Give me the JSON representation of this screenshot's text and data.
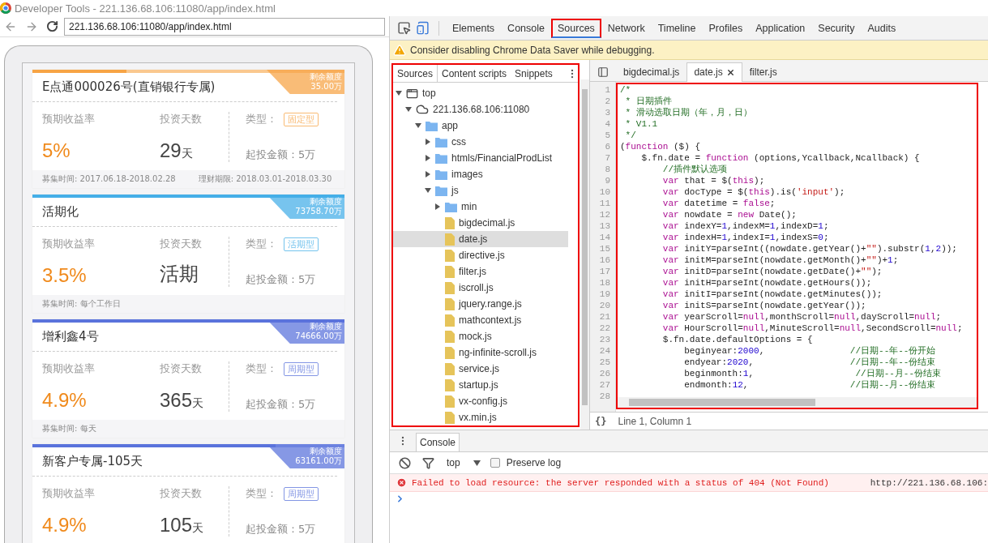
{
  "window": {
    "title": "Developer Tools - 221.136.68.106:11080/app/index.html"
  },
  "browser": {
    "url": "221.136.68.106:11080/app/index.html"
  },
  "products": [
    {
      "name": "E点通000026号(直销银行专属)",
      "color": "#f7a445",
      "level": 0.3,
      "quota_label": "剩余额度",
      "quota_amount": "35.00万",
      "rate_label": "预期收益率",
      "rate": "5%",
      "days_label": "投资天数",
      "days": "29",
      "unit": "天",
      "type_label": "类型：",
      "type": "固定型",
      "min_amount": "起投金额：5万",
      "footer": [
        "募集时间: 2017.06.18-2018.02.28",
        "理财期限: 2018.03.01-2018.03.30"
      ]
    },
    {
      "name": "活期化",
      "color": "#45afe8",
      "level": 1,
      "quota_label": "剩余额度",
      "quota_amount": "73758.70万",
      "rate_label": "预期收益率",
      "rate": "3.5%",
      "days_label": "投资天数",
      "days": "活期",
      "type_label": "类型：",
      "type": "活期型",
      "min_amount": "起投金额：5万",
      "footer": [
        "募集时间: 每个工作日"
      ]
    },
    {
      "name": "增利鑫4号",
      "color": "#5a73dc",
      "level": 1,
      "quota_label": "剩余额度",
      "quota_amount": "74666.00万",
      "rate_label": "预期收益率",
      "rate": "4.9%",
      "days_label": "投资天数",
      "days": "365",
      "unit": "天",
      "type_label": "类型：",
      "type": "周期型",
      "min_amount": "起投金额：5万",
      "footer": [
        "募集时间: 每天"
      ]
    },
    {
      "name": "新客户专属-105天",
      "color": "#5a73dc",
      "level": 0.78,
      "quota_label": "剩余额度",
      "quota_amount": "63161.00万",
      "rate_label": "预期收益率",
      "rate": "4.9%",
      "days_label": "投资天数",
      "days": "105",
      "unit": "天",
      "type_label": "类型：",
      "type": "周期型",
      "min_amount": "起投金额：5万"
    }
  ],
  "devtools": {
    "tabs": [
      {
        "label": "Elements",
        "selected": false,
        "highlighted": false
      },
      {
        "label": "Console",
        "selected": false,
        "highlighted": false
      },
      {
        "label": "Sources",
        "selected": true,
        "highlighted": true
      },
      {
        "label": "Network",
        "selected": false,
        "highlighted": false
      },
      {
        "label": "Timeline",
        "selected": false,
        "highlighted": false
      },
      {
        "label": "Profiles",
        "selected": false,
        "highlighted": false
      },
      {
        "label": "Application",
        "selected": false,
        "highlighted": false
      },
      {
        "label": "Security",
        "selected": false,
        "highlighted": false
      },
      {
        "label": "Audits",
        "selected": false,
        "highlighted": false
      }
    ],
    "warning": "Consider disabling Chrome Data Saver while debugging.",
    "navigator": {
      "highlighted": true,
      "tabs": [
        {
          "label": "Sources",
          "selected": true
        },
        {
          "label": "Content scripts",
          "selected": false
        },
        {
          "label": "Snippets",
          "selected": false
        }
      ],
      "tree": [
        {
          "label": "top",
          "kind": "frame",
          "expanded": true,
          "selected": false,
          "children": [
            {
              "label": "221.136.68.106:11080",
              "kind": "domain",
              "expanded": true,
              "selected": false,
              "children": [
                {
                  "label": "app",
                  "kind": "folder",
                  "expanded": true,
                  "selected": false,
                  "children": [
                    {
                      "label": "css",
                      "kind": "folder",
                      "expanded": false,
                      "selected": false
                    },
                    {
                      "label": "htmls/FinancialProdList",
                      "kind": "folder",
                      "expanded": false,
                      "selected": false
                    },
                    {
                      "label": "images",
                      "kind": "folder",
                      "expanded": false,
                      "selected": false
                    },
                    {
                      "label": "js",
                      "kind": "folder",
                      "expanded": true,
                      "selected": false,
                      "children": [
                        {
                          "label": "min",
                          "kind": "folder",
                          "expanded": false,
                          "selected": false
                        },
                        {
                          "label": "bigdecimal.js",
                          "kind": "file",
                          "selected": false
                        },
                        {
                          "label": "date.js",
                          "kind": "file",
                          "selected": true
                        },
                        {
                          "label": "directive.js",
                          "kind": "file",
                          "selected": false
                        },
                        {
                          "label": "filter.js",
                          "kind": "file",
                          "selected": false
                        },
                        {
                          "label": "iscroll.js",
                          "kind": "file",
                          "selected": false
                        },
                        {
                          "label": "jquery.range.js",
                          "kind": "file",
                          "selected": false
                        },
                        {
                          "label": "mathcontext.js",
                          "kind": "file",
                          "selected": false
                        },
                        {
                          "label": "mock.js",
                          "kind": "file",
                          "selected": false
                        },
                        {
                          "label": "ng-infinite-scroll.js",
                          "kind": "file",
                          "selected": false
                        },
                        {
                          "label": "service.js",
                          "kind": "file",
                          "selected": false
                        },
                        {
                          "label": "startup.js",
                          "kind": "file",
                          "selected": false
                        },
                        {
                          "label": "vx-config.js",
                          "kind": "file",
                          "selected": false
                        },
                        {
                          "label": "vx.min.js",
                          "kind": "file",
                          "selected": false
                        }
                      ]
                    }
                  ]
                }
              ]
            }
          ]
        }
      ]
    },
    "editor": {
      "highlighted": true,
      "tabs": [
        {
          "label": "bigdecimal.js",
          "selected": false,
          "closable": false
        },
        {
          "label": "date.js",
          "selected": true,
          "closable": true
        },
        {
          "label": "filter.js",
          "selected": false,
          "closable": false
        }
      ],
      "lines": [
        {
          "n": "1",
          "seg": [
            {
              "kind": "comment",
              "text": "/*"
            }
          ]
        },
        {
          "n": "2",
          "seg": [
            {
              "kind": "comment",
              "text": " * 日期插件"
            }
          ]
        },
        {
          "n": "3",
          "seg": [
            {
              "kind": "comment",
              "text": " * 滑动选取日期（年，月，日）"
            }
          ]
        },
        {
          "n": "4",
          "seg": [
            {
              "kind": "comment",
              "text": " * V1.1"
            }
          ]
        },
        {
          "n": "5",
          "seg": [
            {
              "kind": "comment",
              "text": " */"
            }
          ]
        },
        {
          "n": "6",
          "seg": [
            {
              "kind": "plain",
              "text": "("
            },
            {
              "kind": "keyword",
              "text": "function"
            },
            {
              "kind": "plain",
              "text": " ($) {"
            }
          ]
        },
        {
          "n": "7",
          "seg": [
            {
              "kind": "plain",
              "text": "    $.fn.date = "
            },
            {
              "kind": "keyword",
              "text": "function"
            },
            {
              "kind": "plain",
              "text": " (options,Ycallback,Ncallback) {"
            }
          ]
        },
        {
          "n": "8",
          "seg": [
            {
              "kind": "comment",
              "text": "        //插件默认选项"
            }
          ]
        },
        {
          "n": "9",
          "seg": [
            {
              "kind": "keyword",
              "text": "        var"
            },
            {
              "kind": "plain",
              "text": " that = $("
            },
            {
              "kind": "keyword",
              "text": "this"
            },
            {
              "kind": "plain",
              "text": ");"
            }
          ]
        },
        {
          "n": "10",
          "seg": [
            {
              "kind": "keyword",
              "text": "        var"
            },
            {
              "kind": "plain",
              "text": " docType = $("
            },
            {
              "kind": "keyword",
              "text": "this"
            },
            {
              "kind": "plain",
              "text": ").is("
            },
            {
              "kind": "string",
              "text": "'input'"
            },
            {
              "kind": "plain",
              "text": ");"
            }
          ]
        },
        {
          "n": "11",
          "seg": [
            {
              "kind": "keyword",
              "text": "        var"
            },
            {
              "kind": "plain",
              "text": " datetime = "
            },
            {
              "kind": "keyword",
              "text": "false"
            },
            {
              "kind": "plain",
              "text": ";"
            }
          ]
        },
        {
          "n": "12",
          "seg": [
            {
              "kind": "keyword",
              "text": "        var"
            },
            {
              "kind": "plain",
              "text": " nowdate = "
            },
            {
              "kind": "keyword",
              "text": "new"
            },
            {
              "kind": "plain",
              "text": " Date();"
            }
          ]
        },
        {
          "n": "13",
          "seg": [
            {
              "kind": "keyword",
              "text": "        var"
            },
            {
              "kind": "plain",
              "text": " indexY="
            },
            {
              "kind": "number",
              "text": "1"
            },
            {
              "kind": "plain",
              "text": ",indexM="
            },
            {
              "kind": "number",
              "text": "1"
            },
            {
              "kind": "plain",
              "text": ",indexD="
            },
            {
              "kind": "number",
              "text": "1"
            },
            {
              "kind": "plain",
              "text": ";"
            }
          ]
        },
        {
          "n": "14",
          "seg": [
            {
              "kind": "keyword",
              "text": "        var"
            },
            {
              "kind": "plain",
              "text": " indexH="
            },
            {
              "kind": "number",
              "text": "1"
            },
            {
              "kind": "plain",
              "text": ",indexI="
            },
            {
              "kind": "number",
              "text": "1"
            },
            {
              "kind": "plain",
              "text": ",indexS="
            },
            {
              "kind": "number",
              "text": "0"
            },
            {
              "kind": "plain",
              "text": ";"
            }
          ]
        },
        {
          "n": "15",
          "seg": [
            {
              "kind": "keyword",
              "text": "        var"
            },
            {
              "kind": "plain",
              "text": " initY=parseInt((nowdate.getYear()+"
            },
            {
              "kind": "string",
              "text": "\"\""
            },
            {
              "kind": "plain",
              "text": ").substr("
            },
            {
              "kind": "number",
              "text": "1"
            },
            {
              "kind": "plain",
              "text": ","
            },
            {
              "kind": "number",
              "text": "2"
            },
            {
              "kind": "plain",
              "text": "));"
            }
          ]
        },
        {
          "n": "16",
          "seg": [
            {
              "kind": "keyword",
              "text": "        var"
            },
            {
              "kind": "plain",
              "text": " initM=parseInt(nowdate.getMonth()+"
            },
            {
              "kind": "string",
              "text": "\"\""
            },
            {
              "kind": "plain",
              "text": ")+"
            },
            {
              "kind": "number",
              "text": "1"
            },
            {
              "kind": "plain",
              "text": ";"
            }
          ]
        },
        {
          "n": "17",
          "seg": [
            {
              "kind": "keyword",
              "text": "        var"
            },
            {
              "kind": "plain",
              "text": " initD=parseInt(nowdate.getDate()+"
            },
            {
              "kind": "string",
              "text": "\"\""
            },
            {
              "kind": "plain",
              "text": ");"
            }
          ]
        },
        {
          "n": "18",
          "seg": [
            {
              "kind": "keyword",
              "text": "        var"
            },
            {
              "kind": "plain",
              "text": " initH=parseInt(nowdate.getHours());"
            }
          ]
        },
        {
          "n": "19",
          "seg": [
            {
              "kind": "keyword",
              "text": "        var"
            },
            {
              "kind": "plain",
              "text": " initI=parseInt(nowdate.getMinutes());"
            }
          ]
        },
        {
          "n": "20",
          "seg": [
            {
              "kind": "keyword",
              "text": "        var"
            },
            {
              "kind": "plain",
              "text": " initS=parseInt(nowdate.getYear());"
            }
          ]
        },
        {
          "n": "21",
          "seg": [
            {
              "kind": "keyword",
              "text": "        var"
            },
            {
              "kind": "plain",
              "text": " yearScroll="
            },
            {
              "kind": "keyword",
              "text": "null"
            },
            {
              "kind": "plain",
              "text": ",monthScroll="
            },
            {
              "kind": "keyword",
              "text": "null"
            },
            {
              "kind": "plain",
              "text": ",dayScroll="
            },
            {
              "kind": "keyword",
              "text": "null"
            },
            {
              "kind": "plain",
              "text": ";"
            }
          ]
        },
        {
          "n": "22",
          "seg": [
            {
              "kind": "keyword",
              "text": "        var"
            },
            {
              "kind": "plain",
              "text": " HourScroll="
            },
            {
              "kind": "keyword",
              "text": "null"
            },
            {
              "kind": "plain",
              "text": ",MinuteScroll="
            },
            {
              "kind": "keyword",
              "text": "null"
            },
            {
              "kind": "plain",
              "text": ",SecondScroll="
            },
            {
              "kind": "keyword",
              "text": "null"
            },
            {
              "kind": "plain",
              "text": ";"
            }
          ]
        },
        {
          "n": "23",
          "seg": [
            {
              "kind": "plain",
              "text": "        $.fn.date.defaultOptions = {"
            }
          ]
        },
        {
          "n": "24",
          "seg": [
            {
              "kind": "plain",
              "text": "            beginyear:"
            },
            {
              "kind": "number",
              "text": "2000"
            },
            {
              "kind": "plain",
              "text": ",                "
            },
            {
              "kind": "comment",
              "text": "//日期--年--份开始"
            }
          ]
        },
        {
          "n": "25",
          "seg": [
            {
              "kind": "plain",
              "text": "            endyear:"
            },
            {
              "kind": "number",
              "text": "2020"
            },
            {
              "kind": "plain",
              "text": ",                  "
            },
            {
              "kind": "comment",
              "text": "//日期--年--份结束"
            }
          ]
        },
        {
          "n": "26",
          "seg": [
            {
              "kind": "plain",
              "text": "            beginmonth:"
            },
            {
              "kind": "number",
              "text": "1"
            },
            {
              "kind": "plain",
              "text": ",                   "
            },
            {
              "kind": "comment",
              "text": "//日期--月--份结束"
            }
          ]
        },
        {
          "n": "27",
          "seg": [
            {
              "kind": "plain",
              "text": "            endmonth:"
            },
            {
              "kind": "number",
              "text": "12"
            },
            {
              "kind": "plain",
              "text": ",                   "
            },
            {
              "kind": "comment",
              "text": "//日期--月--份结束"
            }
          ]
        },
        {
          "n": "28"
        }
      ],
      "format_button": "{}",
      "status": "Line 1, Column 1"
    },
    "console": {
      "drawer_tabs": [
        {
          "label": "Console",
          "selected": true
        }
      ],
      "context": "top",
      "preserve_log": {
        "label": "Preserve log",
        "checked": false
      },
      "messages": [
        {
          "kind": "error",
          "text": "Failed to load resource: the server responded with a status of 404 (Not Found)",
          "source": "http://221.136.68.106:"
        }
      ]
    }
  }
}
